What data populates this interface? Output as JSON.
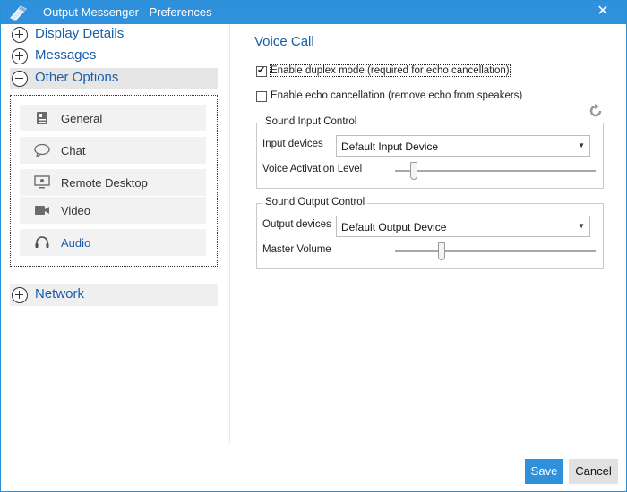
{
  "window": {
    "title": "Output Messenger - Preferences",
    "close_glyph": "✕"
  },
  "sidebar": {
    "categories": [
      {
        "label": "Display Details",
        "state": "collapsed"
      },
      {
        "label": "Messages",
        "state": "collapsed"
      },
      {
        "label": "Other Options",
        "state": "expanded"
      },
      {
        "label": "Network",
        "state": "collapsed"
      }
    ],
    "sub_items": [
      {
        "label": "General",
        "icon": "id-card-icon"
      },
      {
        "label": "Chat",
        "icon": "chat-bubble-icon"
      },
      {
        "label": "Remote Desktop",
        "icon": "monitor-icon"
      },
      {
        "label": "Video",
        "icon": "video-camera-icon"
      },
      {
        "label": "Audio",
        "icon": "headset-icon",
        "selected": true
      }
    ]
  },
  "content": {
    "title": "Voice Call",
    "options": [
      {
        "label": "Enable duplex mode (required for echo cancellation)",
        "checked": true
      },
      {
        "label": "Enable echo cancellation (remove echo from speakers)",
        "checked": false
      }
    ],
    "input_group": {
      "legend": "Sound Input Control",
      "device_label": "Input devices",
      "device_value": "Default Input Device",
      "level_label": "Voice Activation Level",
      "level_value": 0.08
    },
    "output_group": {
      "legend": "Sound Output Control",
      "device_label": "Output devices",
      "device_value": "Default Output Device",
      "level_label": "Master Volume",
      "level_value": 0.22
    }
  },
  "footer": {
    "save_label": "Save",
    "cancel_label": "Cancel"
  },
  "colors": {
    "accent": "#2f91db",
    "link_blue": "#1a5fa8",
    "selected_bg": "#e6e6e6"
  }
}
